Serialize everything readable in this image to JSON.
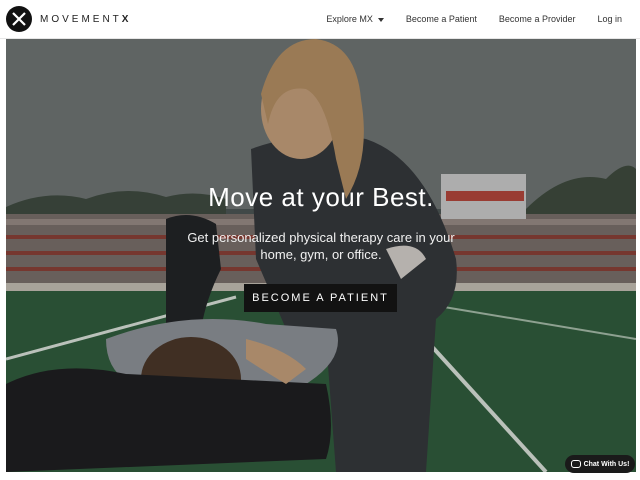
{
  "brand": {
    "name": "MOVEMENT",
    "name_mark": "X"
  },
  "nav": {
    "explore": "Explore MX",
    "patient": "Become a Patient",
    "provider": "Become a Provider",
    "login": "Log in"
  },
  "hero": {
    "title": "Move at your Best.",
    "subtitle": "Get personalized physical therapy care in your home, gym, or office.",
    "cta": "BECOME A PATIENT"
  },
  "chat": {
    "label": "Chat With Us!"
  },
  "colors": {
    "cta_bg": "#121212",
    "nav_bg": "#ffffff",
    "field": "#2e5c3b"
  }
}
